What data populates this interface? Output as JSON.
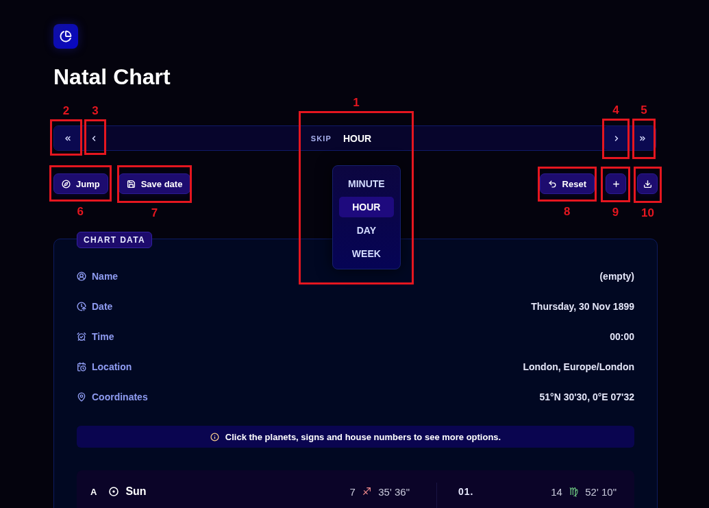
{
  "app": {
    "title": "Natal Chart"
  },
  "skip_bar": {
    "label": "SKIP",
    "value": "HOUR",
    "marker": "1",
    "nav_buttons": [
      {
        "kind": "first",
        "marker": "2"
      },
      {
        "kind": "previous",
        "marker": "3"
      },
      {
        "kind": "next",
        "marker": "4"
      },
      {
        "kind": "last",
        "marker": "5"
      }
    ]
  },
  "skip_menu": {
    "open": true,
    "options": [
      {
        "label": "MINUTE",
        "selected": false
      },
      {
        "label": "HOUR",
        "selected": true
      },
      {
        "label": "DAY",
        "selected": false
      },
      {
        "label": "WEEK",
        "selected": false
      }
    ]
  },
  "actions_left": [
    {
      "kind": "jump",
      "label": "Jump",
      "marker": "6"
    },
    {
      "kind": "save",
      "label": "Save date",
      "marker": "7"
    }
  ],
  "actions_right": [
    {
      "kind": "reset",
      "label": "Reset",
      "marker": "8"
    },
    {
      "kind": "add",
      "marker": "9"
    },
    {
      "kind": "download",
      "marker": "10"
    }
  ],
  "data_card": {
    "legend": "CHART DATA",
    "fields": [
      {
        "kind": "name",
        "label": "Name",
        "value": "(empty)"
      },
      {
        "kind": "date",
        "label": "Date",
        "value": "Thursday, 30 Nov 1899"
      },
      {
        "kind": "time",
        "label": "Time",
        "value": "00:00"
      },
      {
        "kind": "location",
        "label": "Location",
        "value": "London, Europe/London"
      },
      {
        "kind": "coordinates",
        "label": "Coordinates",
        "value": "51°N 30'30, 0°E 07'32"
      }
    ]
  },
  "info": {
    "text": "Click the planets, signs and house numbers to see more options."
  },
  "positions": [
    {
      "tag": "A",
      "kind": "sun",
      "planet": "Sun",
      "degree": "7",
      "sign": {
        "symbol": "♐",
        "color": "#f08a8c"
      },
      "minutes": "35' 36\"",
      "house": "01.",
      "house_degree": "14",
      "house_sign": {
        "symbol": "♍",
        "color": "#78dc8a"
      },
      "house_minutes": "52' 10\""
    }
  ]
}
